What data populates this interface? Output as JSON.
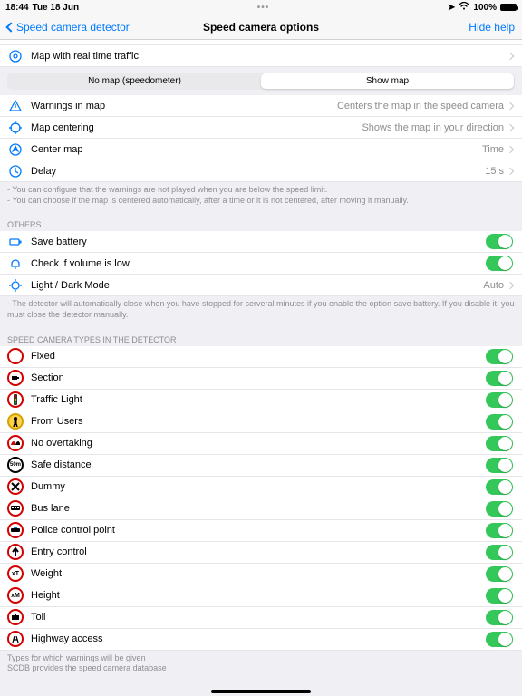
{
  "status": {
    "time": "18:44",
    "date": "Tue 18 Jun",
    "battery": "100%"
  },
  "nav": {
    "back": "Speed camera detector",
    "title": "Speed camera options",
    "right": "Hide help"
  },
  "map_traffic": "Map with real time traffic",
  "segmented": {
    "left": "No map (speedometer)",
    "right": "Show map"
  },
  "rows1": {
    "warnings": {
      "label": "Warnings in map",
      "value": "Centers the map in the speed camera"
    },
    "centering": {
      "label": "Map centering",
      "value": "Shows the map in your direction"
    },
    "centermap": {
      "label": "Center map",
      "value": "Time"
    },
    "delay": {
      "label": "Delay",
      "value": "15 s"
    }
  },
  "note1a": "- You can configure that the warnings are not played when you are below the speed limit.",
  "note1b": "- You can choose if the map is centered automatically, after a time or it is not centered, after moving it manually.",
  "others_header": "OTHERS",
  "rows2": {
    "battery": "Save battery",
    "volume": "Check if volume is low",
    "mode": {
      "label": "Light / Dark Mode",
      "value": "Auto"
    }
  },
  "note2": "- The detector will automatically close when you have stopped for serveral minutes if you enable the option save battery. If you disable it, you must close the detector manually.",
  "types_header": "SPEED CAMERA TYPES IN THE DETECTOR",
  "types": [
    "Fixed",
    "Section",
    "Traffic Light",
    "From Users",
    "No overtaking",
    "Safe distance",
    "Dummy",
    "Bus lane",
    "Police control point",
    "Entry control",
    "Weight",
    "Height",
    "Toll",
    "Highway access"
  ],
  "footer1": "Types for which warnings will be given",
  "footer2": "SCDB provides the speed camera database"
}
